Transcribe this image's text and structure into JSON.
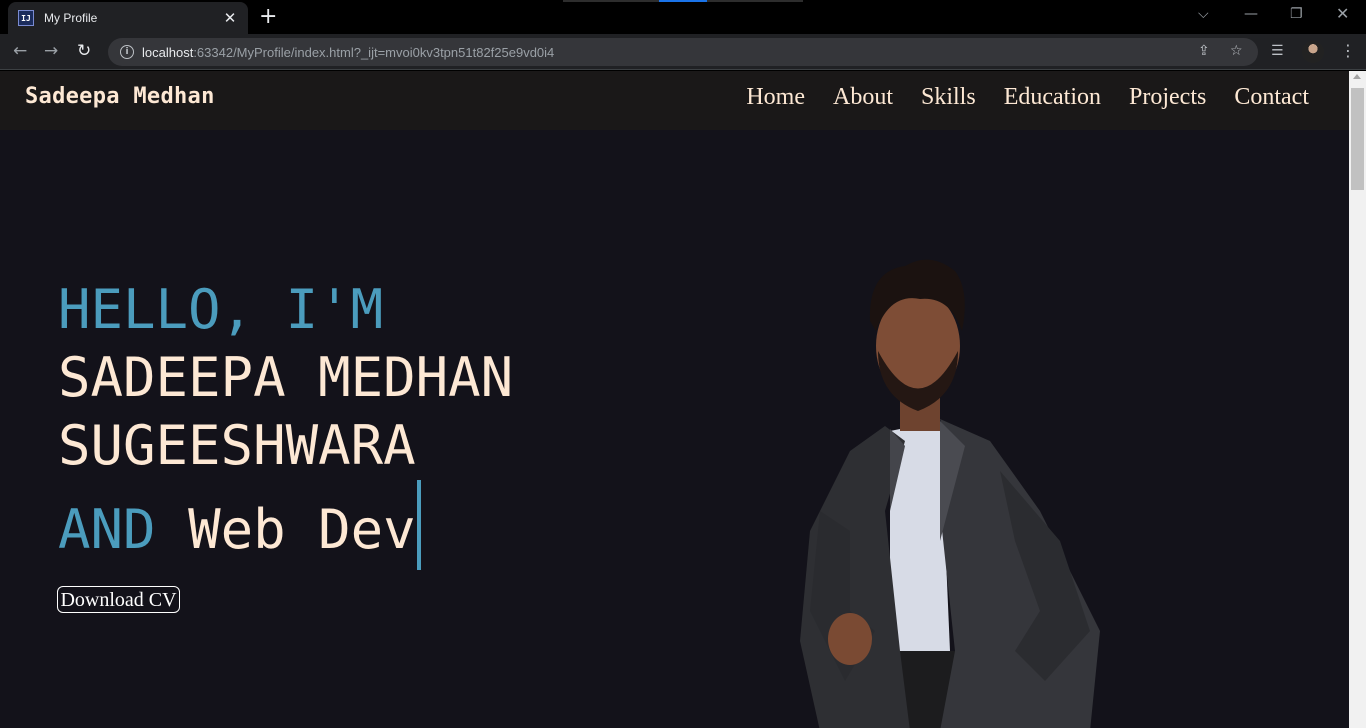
{
  "browser": {
    "tab_title": "My Profile",
    "tab_favicon": "IJ",
    "url_host": "localhost",
    "url_rest": ":63342/MyProfile/index.html?_ijt=mvoi0kv3tpn51t82f25e9vd0i4"
  },
  "site": {
    "brand": "Sadeepa Medhan",
    "nav": [
      "Home",
      "About",
      "Skills",
      "Education",
      "Projects",
      "Contact"
    ]
  },
  "hero": {
    "greeting": "HELLO, I'M",
    "name_line1": "SADEEPA MEDHAN",
    "name_line2": "SUGEESHWARA",
    "and_word": "AND",
    "role_typed": "Web Dev",
    "download_button": "Download CV"
  },
  "colors": {
    "page_bg": "#13121a",
    "header_bg": "#1a1818",
    "text": "#fde8d4",
    "accent": "#4b9cbd"
  }
}
